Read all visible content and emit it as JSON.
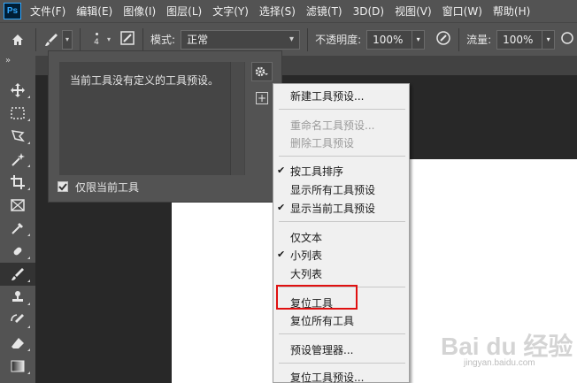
{
  "app": {
    "logo": "Ps"
  },
  "menubar": {
    "items": [
      "文件(F)",
      "编辑(E)",
      "图像(I)",
      "图层(L)",
      "文字(Y)",
      "选择(S)",
      "滤镜(T)",
      "3D(D)",
      "视图(V)",
      "窗口(W)",
      "帮助(H)"
    ]
  },
  "options": {
    "brush_size": "4",
    "mode_label": "模式:",
    "mode_value": "正常",
    "opacity_label": "不透明度:",
    "opacity_value": "100%",
    "flow_label": "流量:",
    "flow_value": "100%"
  },
  "preset_panel": {
    "empty_message": "当前工具没有定义的工具预设。",
    "current_only_label": "仅限当前工具",
    "current_only_checked": true,
    "new_button_glyph": "+"
  },
  "flyout": {
    "items": [
      {
        "label": "新建工具预设...",
        "enabled": true,
        "checked": false
      },
      {
        "label": "重命名工具预设...",
        "enabled": false,
        "checked": false
      },
      {
        "label": "删除工具预设",
        "enabled": false,
        "checked": false
      },
      {
        "label": "按工具排序",
        "enabled": true,
        "checked": true
      },
      {
        "label": "显示所有工具预设",
        "enabled": true,
        "checked": false
      },
      {
        "label": "显示当前工具预设",
        "enabled": true,
        "checked": true
      },
      {
        "label": "仅文本",
        "enabled": true,
        "checked": false
      },
      {
        "label": "小列表",
        "enabled": true,
        "checked": true
      },
      {
        "label": "大列表",
        "enabled": true,
        "checked": false
      },
      {
        "label": "复位工具",
        "enabled": true,
        "checked": false
      },
      {
        "label": "复位所有工具",
        "enabled": true,
        "checked": false
      },
      {
        "label": "预设管理器...",
        "enabled": true,
        "checked": false
      },
      {
        "label": "复位工具预设...",
        "enabled": true,
        "checked": false
      }
    ],
    "check_glyph": "✔"
  },
  "watermark": {
    "main": "Bai du 经验",
    "sub": "jingyan.baidu.com"
  },
  "colors": {
    "highlight": "#e01010",
    "ui_dark": "#535353",
    "menu_bg": "#f0f0f0"
  },
  "icons": [
    "home-icon",
    "brush-icon",
    "gear-icon",
    "airbrush-icon",
    "pressure-icon",
    "move-icon",
    "marquee-icon",
    "lasso-icon",
    "magic-wand-icon",
    "crop-icon",
    "frame-icon",
    "eyedropper-icon",
    "healing-brush-icon",
    "brush-tool-icon",
    "clone-stamp-icon",
    "history-brush-icon",
    "eraser-icon",
    "gradient-icon"
  ]
}
